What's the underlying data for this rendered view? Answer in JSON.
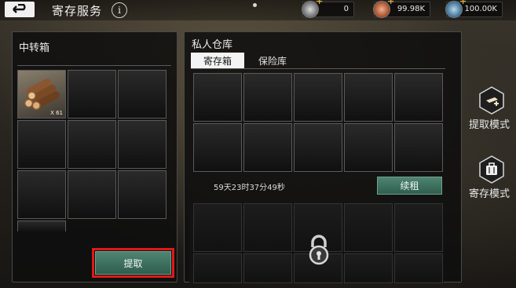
{
  "header": {
    "title": "寄存服务",
    "info_glyph": "i",
    "currencies": [
      {
        "icon": "silver-coin-icon",
        "amount": "0"
      },
      {
        "icon": "copper-coin-icon",
        "amount": "99.98K"
      },
      {
        "icon": "gem-coin-icon",
        "amount": "100.00K"
      }
    ],
    "plus_glyph": "+"
  },
  "transfer_box": {
    "title": "中转箱",
    "items": [
      {
        "name": "wood-logs",
        "count": "X 61"
      }
    ],
    "withdraw_label": "提取"
  },
  "private_warehouse": {
    "title": "私人仓库",
    "tabs": [
      {
        "label": "寄存箱",
        "active": true
      },
      {
        "label": "保险库",
        "active": false
      }
    ],
    "timer": "59天23时37分49秒",
    "renew_label": "续租"
  },
  "side_actions": [
    {
      "label": "提取模式",
      "icon": "withdraw-mode-icon"
    },
    {
      "label": "寄存模式",
      "icon": "deposit-mode-icon"
    }
  ],
  "colors": {
    "accent_green": "#3f7362",
    "highlight_red": "#e01818"
  }
}
